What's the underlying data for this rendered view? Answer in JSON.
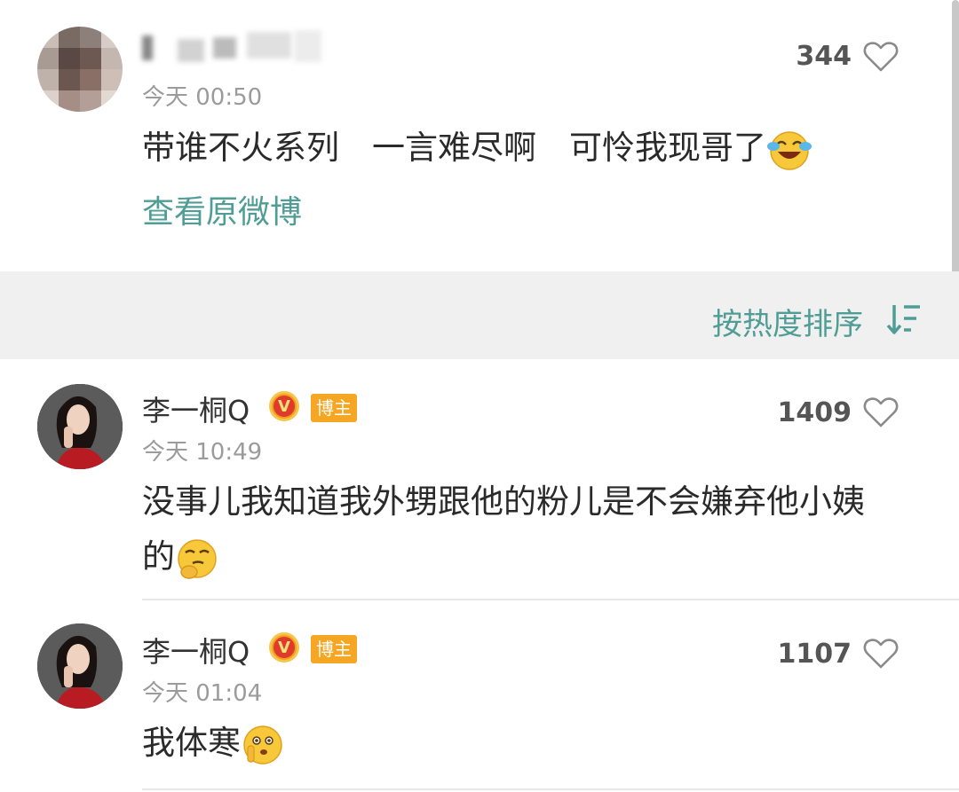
{
  "original_post": {
    "username": "",
    "time": "今天 00:50",
    "likes": "344",
    "text": "带谁不火系列　一言难尽啊　可怜我现哥了",
    "emoji_icon": "laugh-cry-emoji-icon",
    "view_link": "查看原微博"
  },
  "sort_bar": {
    "label": "按热度排序",
    "icon": "sort-descending-icon"
  },
  "comments": [
    {
      "username": "李一桐Q",
      "badge_icon": "verified-v-icon",
      "host_tag": "博主",
      "time": "今天 10:49",
      "likes": "1409",
      "text_line1": "没事儿我知道我外甥跟他的粉儿是不会嫌弃他小姨",
      "text_line2": "的",
      "emoji_icon": "thinking-smirk-emoji-icon"
    },
    {
      "username": "李一桐Q",
      "badge_icon": "verified-v-icon",
      "host_tag": "博主",
      "time": "今天 01:04",
      "likes": "1107",
      "text_line1": "我体寒",
      "emoji_icon": "shush-emoji-icon"
    }
  ],
  "colors": {
    "link": "#4f9d95",
    "sort_bar_bg": "#f0f0f0",
    "host_tag": "#f5a623",
    "verified": "#e03a2c"
  }
}
